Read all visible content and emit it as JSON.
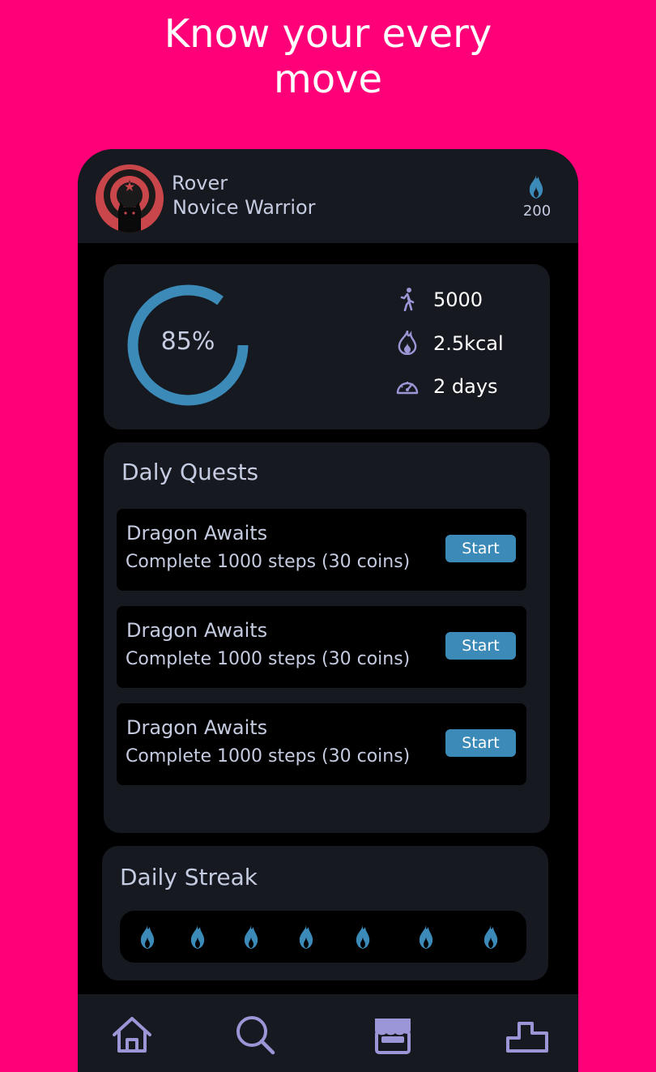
{
  "headline": {
    "line1": "Know your every",
    "line2": "move"
  },
  "profile": {
    "name": "Rover",
    "rank": "Novice Warrior",
    "coins": "200",
    "coin_icon": "flame-icon"
  },
  "progress": {
    "percent_label": "85%",
    "percent_value": 0.85
  },
  "stats": [
    {
      "icon": "walking-icon",
      "value": "5000"
    },
    {
      "icon": "flame-icon",
      "value": "2.5kcal"
    },
    {
      "icon": "speedometer-icon",
      "value": "2 days"
    }
  ],
  "quests": {
    "title": "Daly Quests",
    "items": [
      {
        "title": "Dragon Awaits",
        "description": "Complete 1000 steps (30 coins)",
        "button": "Start"
      },
      {
        "title": "Dragon Awaits",
        "description": "Complete 1000 steps (30 coins)",
        "button": "Start"
      },
      {
        "title": "Dragon Awaits",
        "description": "Complete 1000 steps (30 coins)",
        "button": "Start"
      }
    ]
  },
  "streak": {
    "title": "Daily Streak",
    "days": 7
  },
  "nav": {
    "items": [
      "home-icon",
      "search-icon",
      "store-icon",
      "leaderboard-icon"
    ]
  },
  "colors": {
    "background": "#FF0078",
    "panel": "#161920",
    "accent": "#3b8ab8",
    "text_muted": "#c5cbe0",
    "icon_purple": "#9b96d6",
    "avatar_red": "#c9474a"
  }
}
